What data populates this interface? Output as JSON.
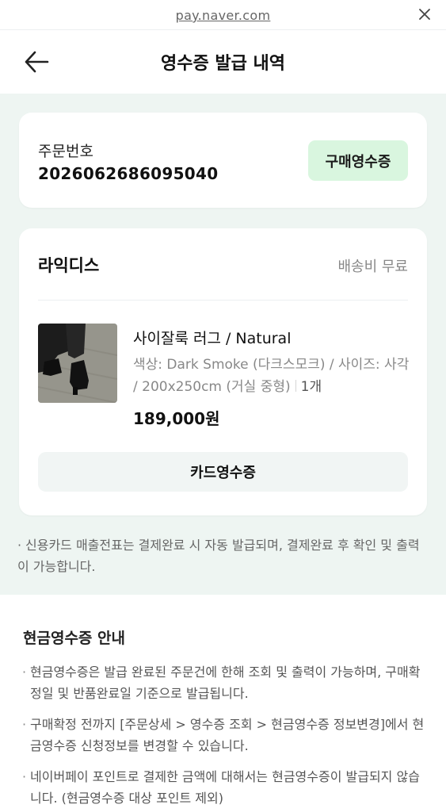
{
  "browser": {
    "url": "pay.naver.com"
  },
  "header": {
    "title": "영수증 발급 내역"
  },
  "order": {
    "label": "주문번호",
    "number": "2026062686095040",
    "receipt_badge": "구매영수증"
  },
  "item_card": {
    "store": "라익디스",
    "shipping": "배송비 무료",
    "product_name": "사이잘룩 러그 / Natural",
    "product_options": "색상: Dark Smoke (다크스모크) / 사이즈: 사각 / 200x250cm (거실 중형)",
    "quantity": "1개",
    "price_number": "189,000",
    "price_unit": "원",
    "card_receipt_button": "카드영수증",
    "thumbnail_icon": "product-photo-rug"
  },
  "notice": "신용카드 매출전표는 결제완료 시 자동 발급되며, 결제완료 후 확인 및 출력이 가능합니다.",
  "cash_receipt": {
    "title": "현금영수증 안내",
    "bullets": [
      "현금영수증은 발급 완료된 주문건에 한해 조회 및 출력이 가능하며, 구매확정일 및 반품완료일 기준으로 발급됩니다.",
      "구매확정 전까지 [주문상세 > 영수증 조회 > 현금영수증 정보변경]에서 현금영수증 신청정보를 변경할 수 있습니다.",
      "네이버페이 포인트로 결제한 금액에 대해서는 현금영수증이 발급되지 않습니다. (현금영수증 대상 포인트 제외)"
    ]
  },
  "colors": {
    "page_bg": "#eef5f2",
    "badge_bg": "#d9f6df",
    "button_bg": "#f1f5f4"
  }
}
